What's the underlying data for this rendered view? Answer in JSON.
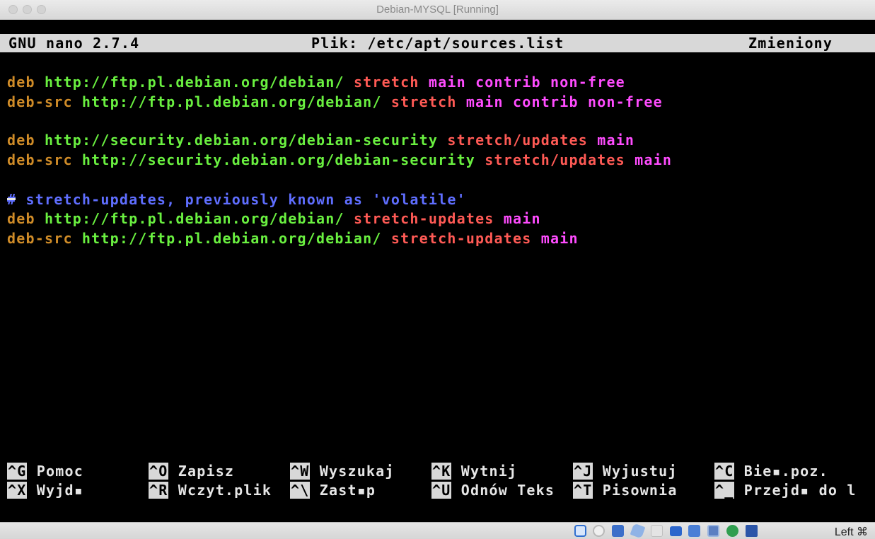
{
  "window": {
    "title": "Debian-MYSQL [Running]"
  },
  "nano": {
    "header": {
      "version": "GNU nano 2.7.4",
      "file": "Plik: /etc/apt/sources.list",
      "status": "Zmieniony"
    },
    "lines": [
      {
        "t1": "deb",
        "t2": " http://ftp.pl.debian.org/debian/ ",
        "t3": "stretch",
        "t4": " main contrib non-free"
      },
      {
        "t1": "deb-src",
        "t2": " http://ftp.pl.debian.org/debian/ ",
        "t3": "stretch",
        "t4": " main contrib non-free"
      },
      {
        "t1": "deb",
        "t2": " http://security.debian.org/debian-security ",
        "t3": "stretch/updates",
        "t4": " main"
      },
      {
        "t1": "deb-src",
        "t2": " http://security.debian.org/debian-security ",
        "t3": "stretch/updates",
        "t4": " main"
      },
      {
        "comment": "# stretch-updates, previously known as 'volatile'"
      },
      {
        "t1": "deb",
        "t2": " http://ftp.pl.debian.org/debian/ ",
        "t3": "stretch-updates",
        "t4": " main"
      },
      {
        "t1": "deb-src",
        "t2": " http://ftp.pl.debian.org/debian/ ",
        "t3": "stretch-updates",
        "t4": " main"
      }
    ],
    "shortcuts_row1": [
      {
        "key": "^G",
        "label": " Pomoc"
      },
      {
        "key": "^O",
        "label": " Zapisz"
      },
      {
        "key": "^W",
        "label": " Wyszukaj"
      },
      {
        "key": "^K",
        "label": " Wytnij"
      },
      {
        "key": "^J",
        "label": " Wyjustuj"
      },
      {
        "key": "^C",
        "label": " Bie▪.poz."
      }
    ],
    "shortcuts_row2": [
      {
        "key": "^X",
        "label": " Wyjd▪"
      },
      {
        "key": "^R",
        "label": " Wczyt.plik"
      },
      {
        "key": "^\\",
        "label": " Zast▪p"
      },
      {
        "key": "^U",
        "label": " Odnów Teks"
      },
      {
        "key": "^T",
        "label": " Pisownia"
      },
      {
        "key": "^_",
        "label": " Przejd▪ do l"
      }
    ]
  },
  "statusbar": {
    "host_key": "Left ⌘",
    "icons": [
      "hard-disk-icon",
      "optical-disk-icon",
      "usb-icon",
      "shared-folders-icon",
      "display-icon",
      "video-capture-icon",
      "network-icon",
      "cpu-icon",
      "guest-additions-icon",
      "keyboard-capture-icon"
    ]
  },
  "colors": {
    "keyword": "#d08c28",
    "url": "#6af040",
    "release": "#ff5a55",
    "component": "#ff4cff",
    "comment": "#5f6eff",
    "header_bg": "#d8d8d8",
    "console_bg": "#000000"
  }
}
